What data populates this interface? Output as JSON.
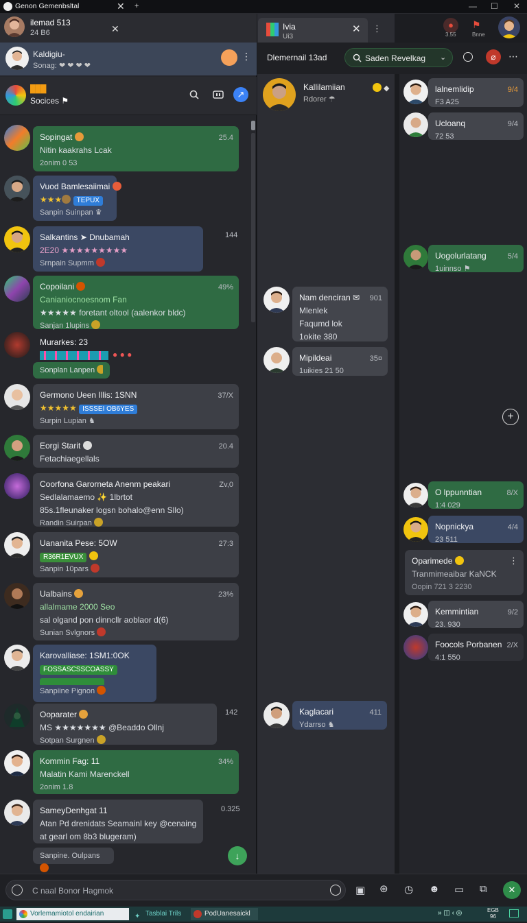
{
  "window": {
    "title": "Genon Gemenbsltal",
    "tab_plus": "+",
    "status_left": "ilemad 513",
    "status_left_sub": "24 B6",
    "right_badges": [
      "3.55",
      "Bnne"
    ]
  },
  "left_header": {
    "name": "Kaldigiu-",
    "sub": "Sonag:",
    "sub_icons": "❤ ❤ ❤ ❤",
    "section_title": "███",
    "section_sub": "Socices"
  },
  "messages": [
    {
      "title": "Sopingat",
      "line1": "Nitin kaakrahs Lcak",
      "meta": "2onim 0 53",
      "time": "25.4"
    },
    {
      "title": "Vuod Bamlesaiimai",
      "tag": "TEPUX",
      "meta": "Sanpin Suinpan"
    },
    {
      "title": "Salkantins ➤ Dnubamah",
      "line1": "2E20 ★★★★★★★★★",
      "meta": "Srnpain Supmm",
      "time": "144"
    },
    {
      "title": "Copoilani",
      "line1": "Canianiocnoesnom Fan",
      "line2": "★★★★★ foretant oltool (aalenkor bldc)",
      "meta": "Sanjan 1lupins",
      "time": "49%"
    },
    {
      "title": "Murarkes: 23",
      "tag": "Sonplan Lanpen"
    },
    {
      "title": "Germono Ueen Illis: 1SNN",
      "tag": "ISSSEI OB6YES",
      "meta": "Surpin Lupian",
      "time": "37/X"
    },
    {
      "title": "Eorgi Starit",
      "line1": "Fetachiaegellals",
      "time": "20.4"
    },
    {
      "title": "Coorfona Garorneta Anenm peakari",
      "line1": "Sedlalamaemo ✨ 1lbrtot",
      "line2": "85s.1fleunaker logsn bohalo@enn Sllo)",
      "meta": "Randin Suirpan",
      "time": "Zv,0"
    },
    {
      "title": "Uananita Pese: 5OW",
      "tag": "R36R1EVUX",
      "meta": "Sanpin 10pars",
      "time": "27:3"
    },
    {
      "title": "Ualbains",
      "line1": "allalmame 2000 Seo",
      "line2": "sal olgand pon dinncllr aoblaor d(6)",
      "meta": "Sunian Svlgnors",
      "time": "23%"
    },
    {
      "title": "Karovalliase: 1SM1:0OK",
      "tag": "FOSSASCSSCOASSY",
      "meta": "Sanpiine Pignon"
    },
    {
      "title": "Ooparater",
      "line1": "MS ★★★★★★★ @Beaddo Ollnj",
      "meta": "Sotpan Surgnen",
      "time": "142"
    },
    {
      "title": "Kommin Fag: 11",
      "line1": "Malatin Kami Marenckell",
      "meta": "2onim 1.8",
      "time": "34%"
    },
    {
      "title": "SameyDenhgat 11",
      "line1": "Atan Pd drenidats Seamainl key @cenaing",
      "line2": "at gearl om 8b3 blugeram)",
      "time": "0.325"
    },
    {
      "meta": "Sanpine. Oulpans"
    }
  ],
  "middle": {
    "tab_title": "Ivia",
    "tab_sub": "Ui3",
    "chat_title": "Dlemernail 13ad",
    "search_label": "Saden Revelkag",
    "contacts": [
      {
        "name": "Kallilamiian",
        "sub": "Rdorer"
      },
      {
        "name": "Nam denciran",
        "line1": "Mlenlek",
        "line2": "Faqumd lok",
        "line3": "1okite 380",
        "time": "901"
      },
      {
        "name": "Mipildeai",
        "sub": "1uikies 21 50",
        "time": "35¤"
      },
      {
        "name": "Kaglacari",
        "sub": "Ydarrso",
        "time": "411"
      }
    ]
  },
  "right": {
    "items": [
      {
        "name": "lalnemlidip",
        "sub": "F3 A25",
        "time": "9/4"
      },
      {
        "name": "Ucloanq",
        "sub": "72 53",
        "time": "9/4"
      },
      {
        "name": "Uogolurlatang",
        "sub": "1uinnso",
        "time": "5/4"
      },
      {
        "name": "O lppunntian",
        "sub": "1:4 029",
        "time": "8/X"
      },
      {
        "name": "Nopnickya",
        "sub": "23 511",
        "time": "4/4"
      },
      {
        "name": "Oparimede",
        "line1": "Tranmimeaibar KaNCK",
        "sub": "Oopin 721 3 2230"
      },
      {
        "name": "Kemmintian",
        "sub": "23. 930",
        "time": "9/2"
      },
      {
        "name": "Foocols Porbanen",
        "sub": "4:1 550",
        "time": "2/X"
      }
    ]
  },
  "composer": {
    "placeholder": "C naal Bonor Hagmok"
  },
  "taskbar": {
    "tabs": [
      "Vorlemamiotol endairian",
      "Tasblai Trils",
      "PodUanesaickl"
    ],
    "clock_top": "EGB",
    "clock_bottom": "96"
  },
  "colors": {
    "green": "#2f6b43",
    "gray": "#3d3f46",
    "blue": "#3b4863",
    "accent": "#3ea35a"
  }
}
